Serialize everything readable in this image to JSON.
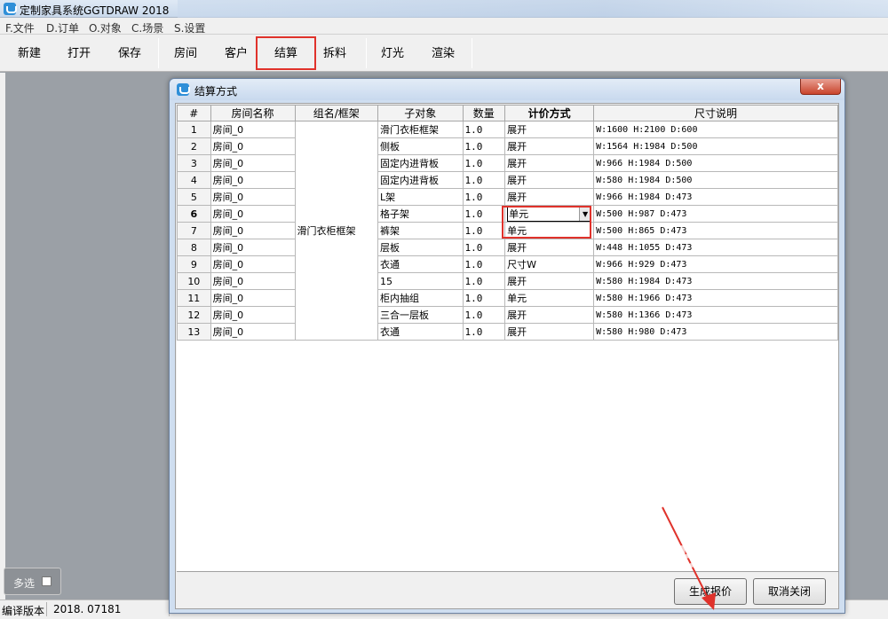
{
  "window": {
    "title": "定制家具系统GGTDRAW 2018"
  },
  "menu": [
    "F.文件",
    "D.订单",
    "O.对象",
    "C.场景",
    "S.设置"
  ],
  "toolbar": {
    "new": "新建",
    "open": "打开",
    "save": "保存",
    "room": "房间",
    "client": "客户",
    "settle": "结算",
    "split": "拆料",
    "light": "灯光",
    "render": "渲染"
  },
  "multiselect_label": "多选",
  "status": {
    "label": "编译版本",
    "value": "2018. 07181"
  },
  "dialog": {
    "title": "结算方式",
    "close": "x",
    "headers": [
      "#",
      "房间名称",
      "组名/框架",
      "子对象",
      "数量",
      "计价方式",
      "尺寸说明"
    ],
    "group": "滑门衣柜框架",
    "rows": [
      {
        "n": "1",
        "room": "房间_0",
        "child": "滑门衣柜框架",
        "qty": "1.0",
        "price": "展开",
        "size": "W:1600 H:2100 D:600"
      },
      {
        "n": "2",
        "room": "房间_0",
        "child": "侧板",
        "qty": "1.0",
        "price": "展开",
        "size": "W:1564 H:1984 D:500"
      },
      {
        "n": "3",
        "room": "房间_0",
        "child": "固定内进背板",
        "qty": "1.0",
        "price": "展开",
        "size": "W:966 H:1984 D:500"
      },
      {
        "n": "4",
        "room": "房间_0",
        "child": "固定内进背板",
        "qty": "1.0",
        "price": "展开",
        "size": "W:580 H:1984 D:500"
      },
      {
        "n": "5",
        "room": "房间_0",
        "child": "L架",
        "qty": "1.0",
        "price": "展开",
        "size": "W:966 H:1984 D:473"
      },
      {
        "n": "6",
        "room": "房间_0",
        "child": "格子架",
        "qty": "1.0",
        "price": "单元",
        "size": "W:500 H:987 D:473"
      },
      {
        "n": "7",
        "room": "房间_0",
        "child": "裤架",
        "qty": "1.0",
        "price": "单元",
        "size": "W:500 H:865 D:473"
      },
      {
        "n": "8",
        "room": "房间_0",
        "child": "层板",
        "qty": "1.0",
        "price": "展开",
        "size": "W:448 H:1055 D:473"
      },
      {
        "n": "9",
        "room": "房间_0",
        "child": "衣通",
        "qty": "1.0",
        "price": "尺寸W",
        "size": "W:966 H:929 D:473"
      },
      {
        "n": "10",
        "room": "房间_0",
        "child": "15",
        "qty": "1.0",
        "price": "展开",
        "size": "W:580 H:1984 D:473"
      },
      {
        "n": "11",
        "room": "房间_0",
        "child": "柜内抽组",
        "qty": "1.0",
        "price": "单元",
        "size": "W:580 H:1966 D:473"
      },
      {
        "n": "12",
        "room": "房间_0",
        "child": "三合一层板",
        "qty": "1.0",
        "price": "展开",
        "size": "W:580 H:1366 D:473"
      },
      {
        "n": "13",
        "room": "房间_0",
        "child": "衣通",
        "qty": "1.0",
        "price": "展开",
        "size": "W:580 H:980 D:473"
      }
    ],
    "buttons": {
      "generate": "生成报价",
      "cancel": "取消关闭"
    }
  },
  "watermark": "Baidu经验",
  "colors": {
    "highlight": "#e0322b",
    "workspace": "#9ba0a6",
    "dialog_frame": "#cfdef0"
  }
}
